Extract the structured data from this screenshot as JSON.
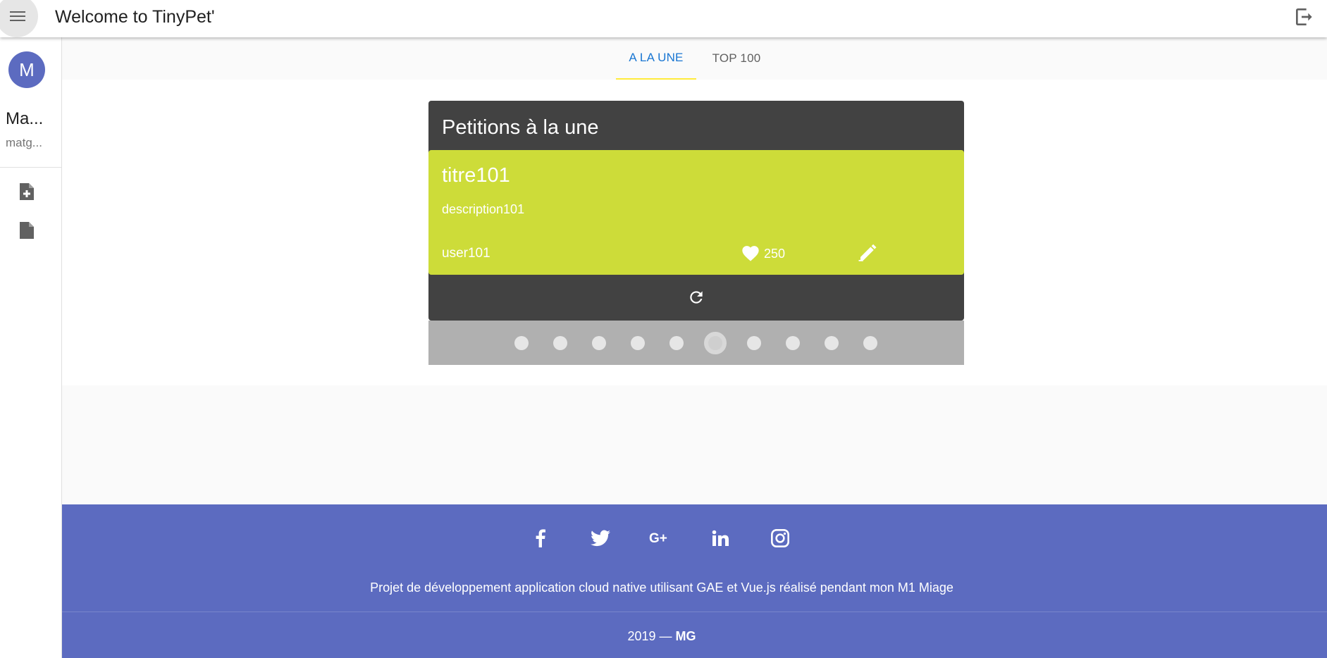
{
  "header": {
    "title": "Welcome to TinyPet'",
    "menu_icon": "menu-icon",
    "logout_icon": "logout-icon"
  },
  "sidebar": {
    "avatar_initial": "M",
    "user_name": "Ma...",
    "user_email": "matg...",
    "items": [
      {
        "icon": "file-add-icon"
      },
      {
        "icon": "file-icon"
      }
    ]
  },
  "tabs": [
    {
      "label": "A LA UNE",
      "active": true
    },
    {
      "label": "TOP 100",
      "active": false
    }
  ],
  "carousel": {
    "heading": "Petitions à la une",
    "petition": {
      "title": "titre101",
      "description": "description101",
      "user": "user101",
      "likes": "250"
    },
    "slide_count": 10,
    "active_slide": 6
  },
  "footer": {
    "social": [
      "facebook-icon",
      "twitter-icon",
      "google-plus-icon",
      "linkedin-icon",
      "instagram-icon"
    ],
    "text": "Projet de développement application cloud native utilisant GAE et Vue.js réalisé pendant mon M1 Miage",
    "copyright_year": "2019 —",
    "copyright_author": "MG"
  },
  "colors": {
    "primary": "#5c6bc0",
    "accent": "#cddc39",
    "tab_active": "#1976d2",
    "tab_indicator": "#ffeb3b",
    "card_dark": "#424242"
  }
}
